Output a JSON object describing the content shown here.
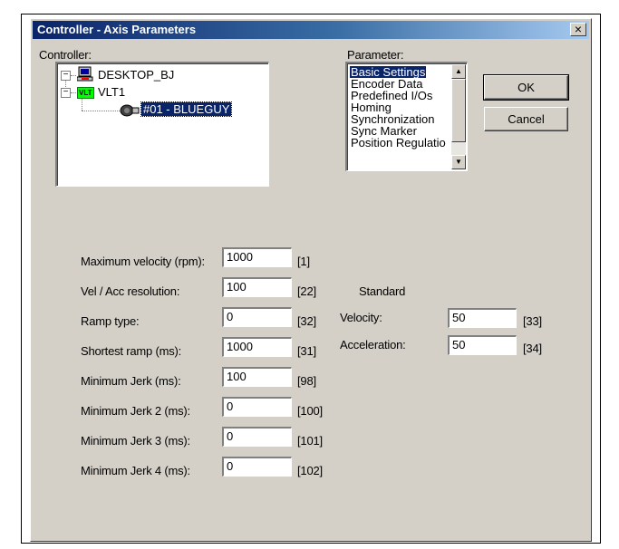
{
  "window": {
    "title": "Controller - Axis Parameters",
    "close_glyph": "×"
  },
  "controller": {
    "label": "Controller:",
    "tree": {
      "root": "DESKTOP_BJ",
      "child": "VLT1",
      "child_badge": "VLT",
      "leaf": "#01 - BLUEGUY"
    }
  },
  "parameter": {
    "label": "Parameter:",
    "items": [
      "Basic Settings",
      "Encoder Data",
      "Predefined I/Os",
      "Homing",
      "Synchronization",
      "Sync Marker",
      "Position Regulatio"
    ],
    "selected_index": 0
  },
  "buttons": {
    "ok": "OK",
    "cancel": "Cancel"
  },
  "settings": [
    {
      "label": "Maximum velocity (rpm):",
      "value": "1000",
      "code": "[1]"
    },
    {
      "label": "Vel / Acc resolution:",
      "value": "100",
      "code": "[22]"
    },
    {
      "label": "Ramp type:",
      "value": "0",
      "code": "[32]"
    },
    {
      "label": "Shortest ramp (ms):",
      "value": "1000",
      "code": "[31]"
    },
    {
      "label": "Minimum Jerk (ms):",
      "value": "100",
      "code": "[98]"
    },
    {
      "label": "Minimum Jerk 2 (ms):",
      "value": "0",
      "code": "[100]"
    },
    {
      "label": "Minimum Jerk 3 (ms):",
      "value": "0",
      "code": "[101]"
    },
    {
      "label": "Minimum Jerk 4 (ms):",
      "value": "0",
      "code": "[102]"
    }
  ],
  "standard": {
    "heading": "Standard",
    "velocity": {
      "label": "Velocity:",
      "value": "50",
      "code": "[33]"
    },
    "acceleration": {
      "label": "Acceleration:",
      "value": "50",
      "code": "[34]"
    }
  },
  "colors": {
    "dialog_bg": "#d4d0c8",
    "title_start": "#0a246a",
    "title_end": "#a6caf0",
    "selection": "#0a246a",
    "badge_green": "#00ff00"
  }
}
